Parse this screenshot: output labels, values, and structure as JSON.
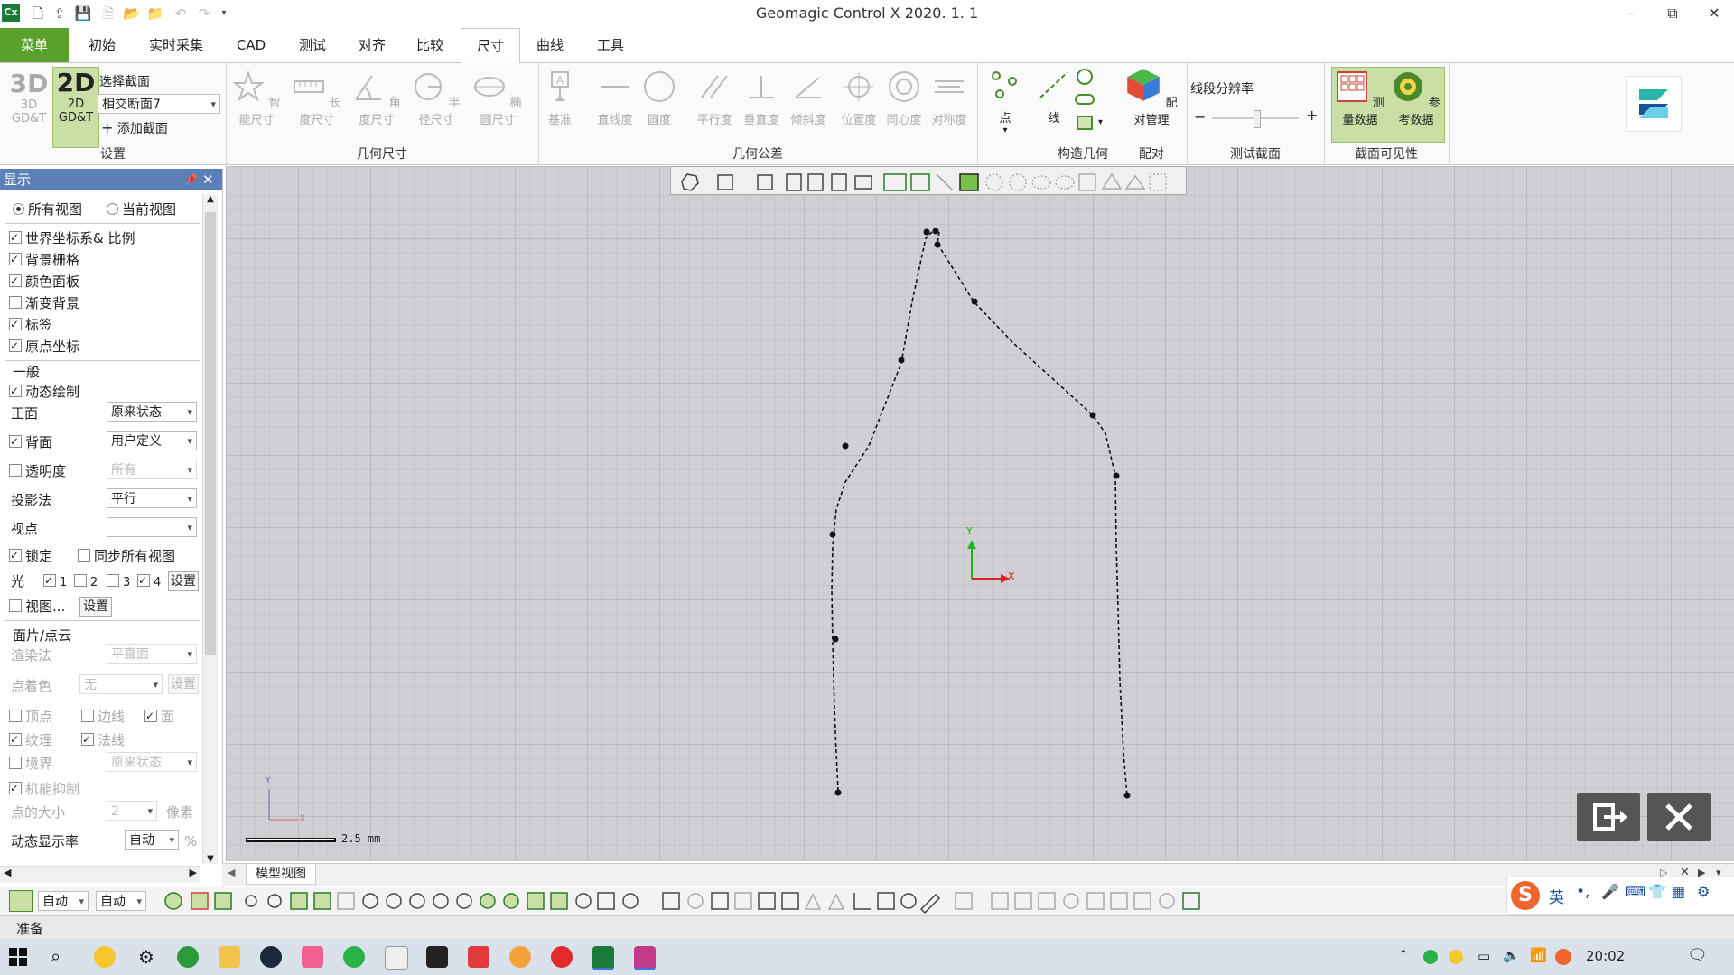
{
  "window": {
    "title": "Geomagic Control X 2020. 1. 1",
    "app_badge": "Cx",
    "controls": {
      "minimize": "–",
      "restore": "⧉",
      "close": "✕"
    }
  },
  "menu_tabs": [
    "菜单",
    "初始",
    "实时采集",
    "CAD",
    "测试",
    "对齐",
    "比较",
    "尺寸",
    "曲线",
    "工具"
  ],
  "active_tab": "尺寸",
  "ribbon": {
    "settings": {
      "label": "设置",
      "btn_3d": "3D",
      "btn_3d_sub": "3D GD&T",
      "btn_2d": "2D",
      "btn_2d_sub": "2D GD&T",
      "select_section_label": "选择截面",
      "select_section_value": "相交断面7",
      "add_section": "添加截面"
    },
    "geometric_dimension": {
      "label": "几何尺寸",
      "items": [
        "智能尺寸",
        "长度尺寸",
        "角度尺寸",
        "半径尺寸",
        "椭圆尺寸"
      ]
    },
    "geometric_tolerance": {
      "label": "几何公差",
      "items": [
        "基准",
        "直线度",
        "圆度",
        "平行度",
        "垂直度",
        "倾斜度",
        "位置度",
        "同心度",
        "对称度"
      ]
    },
    "construct_geometry": {
      "label": "构造几何",
      "items": [
        "点",
        "线"
      ]
    },
    "alignment": {
      "label": "配对",
      "items": [
        "配对管理"
      ]
    },
    "test_section": {
      "label": "测试截面",
      "resolution_label": "线段分辨率",
      "minus": "−",
      "plus": "+"
    },
    "section_visibility": {
      "label": "截面可见性",
      "items": [
        "测量数据",
        "参考数据"
      ]
    }
  },
  "left_panel": {
    "title": "显示",
    "view_scope": {
      "all": "所有视图",
      "current": "当前视图"
    },
    "display_items": [
      {
        "label": "世界坐标系& 比例",
        "checked": true
      },
      {
        "label": "背景栅格",
        "checked": true
      },
      {
        "label": "颜色面板",
        "checked": true
      },
      {
        "label": "渐变背景",
        "checked": false
      },
      {
        "label": "标签",
        "checked": true
      },
      {
        "label": "原点坐标",
        "checked": true
      }
    ],
    "general": {
      "header": "一般",
      "dynamic_draw": "动态绘制",
      "front_label": "正面",
      "front_value": "原来状态",
      "back_label": "背面",
      "back_value": "用户定义",
      "transparency_label": "透明度",
      "transparency_value": "所有",
      "projection_label": "投影法",
      "projection_value": "平行",
      "viewpoint_label": "视点",
      "viewpoint_value": "",
      "lock_label": "锁定",
      "sync_label": "同步所有视图",
      "light_label": "光",
      "lights": [
        "1",
        "2",
        "3",
        "4"
      ],
      "light_settings": "设置",
      "view_label": "视图...",
      "view_settings": "设置"
    },
    "mesh": {
      "header": "面片/点云",
      "render_label": "渲染法",
      "render_value": "平直面",
      "point_color_label": "点着色",
      "point_color_value": "无",
      "point_color_settings": "设置",
      "vertex": "顶点",
      "edge": "边线",
      "face": "面",
      "texture": "纹理",
      "normal": "法线",
      "boundary_label": "境界",
      "boundary_value": "原来状态",
      "suppress": "机能抑制",
      "point_size_label": "点的大小",
      "point_size_value": "2",
      "point_size_unit": "像素",
      "dynamic_rate_label": "动态显示率",
      "dynamic_rate_value": "自动",
      "dynamic_rate_unit": "%"
    }
  },
  "viewport": {
    "scale_label": "2.5 mm",
    "axis_x": "X",
    "axis_y": "Y",
    "exit_icon": "exit-icon",
    "close_icon": "close-icon"
  },
  "view_tab": "模型视图",
  "bottom_toolbar": {
    "select1": "自动",
    "select2": "自动"
  },
  "status": "准备",
  "taskbar": {
    "time": "20:02",
    "ime": "英"
  }
}
